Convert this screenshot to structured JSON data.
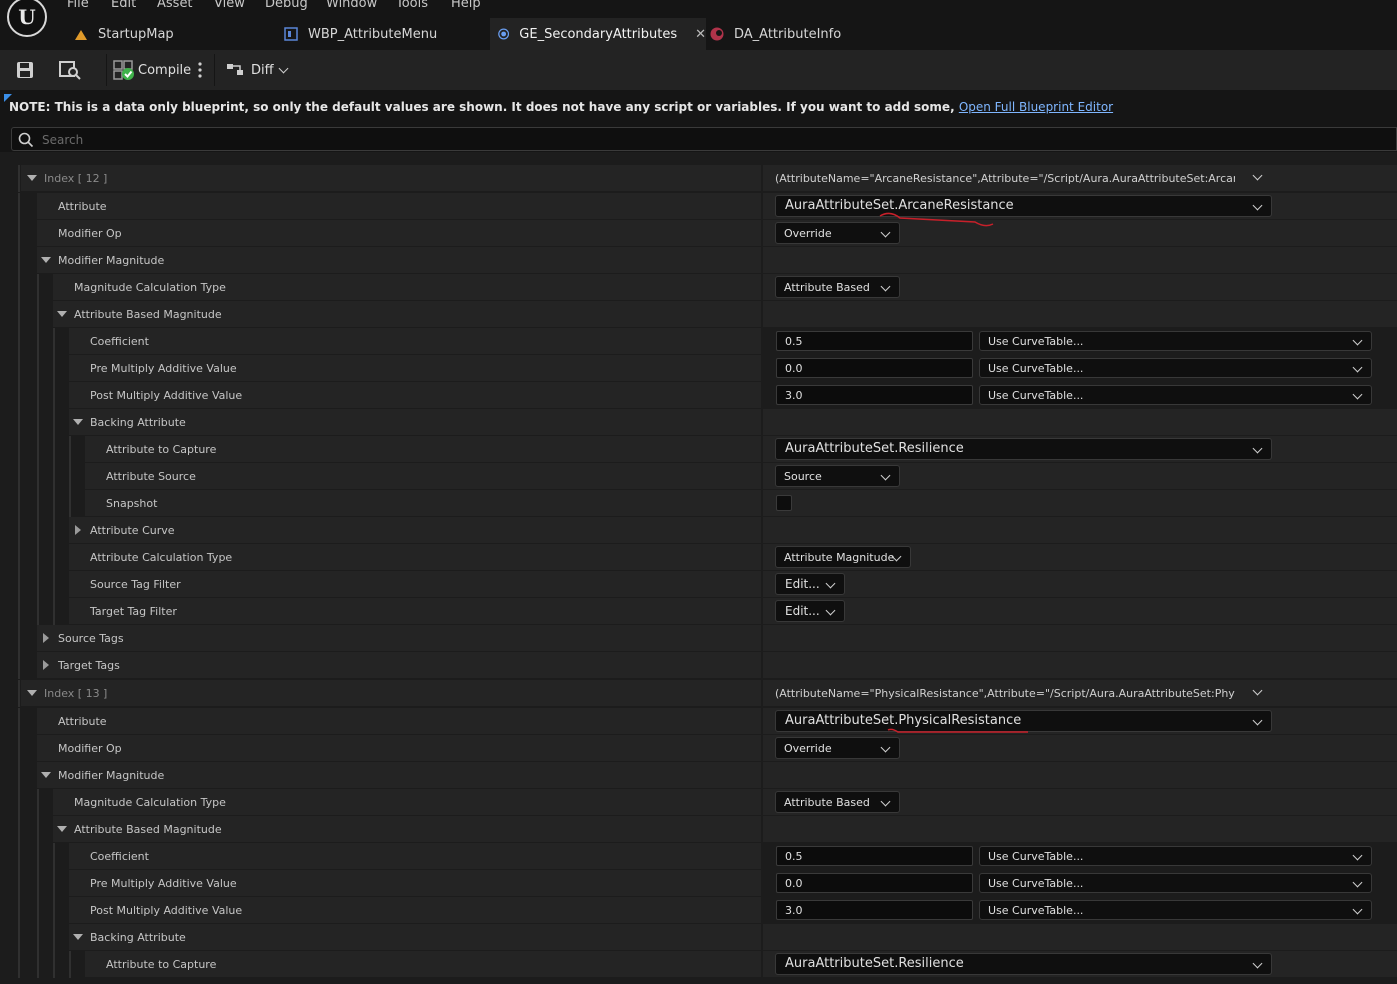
{
  "menu": [
    "File",
    "Edit",
    "Asset",
    "View",
    "Debug",
    "Window",
    "Tools",
    "Help"
  ],
  "tabs": [
    {
      "label": "StartupMap",
      "icon": "level-icon"
    },
    {
      "label": "WBP_AttributeMenu",
      "icon": "widget-blueprint-icon"
    },
    {
      "label": "GE_SecondaryAttributes",
      "icon": "gameplay-effect-icon",
      "active": true
    },
    {
      "label": "DA_AttributeInfo",
      "icon": "data-asset-icon"
    }
  ],
  "toolbar": {
    "compile_label": "Compile",
    "diff_label": "Diff"
  },
  "note": {
    "text": "NOTE: This is a data only blueprint, so only the default values are shown.  It does not have any script or variables.  If you want to add some, ",
    "link": "Open Full Blueprint Editor"
  },
  "search": {
    "placeholder": "Search"
  },
  "groups": [
    {
      "index_label": "Index [ 12 ]",
      "summary": "(AttributeName=\"ArcaneResistance\",Attribute=\"/Script/Aura.AuraAttributeSet:ArcaneResistance\",AttributeOwner=None)",
      "attribute_label": "Attribute",
      "attribute_value": "AuraAttributeSet.ArcaneResistance",
      "modifier_op_label": "Modifier Op",
      "modifier_op_value": "Override",
      "modifier_magnitude_label": "Modifier Magnitude",
      "mag_calc_type_label": "Magnitude Calculation Type",
      "mag_calc_type_value": "Attribute Based",
      "attr_based_mag_label": "Attribute Based Magnitude",
      "coefficient_label": "Coefficient",
      "coefficient_value": "0.5",
      "pre_mult_label": "Pre Multiply Additive Value",
      "pre_mult_value": "0.0",
      "post_mult_label": "Post Multiply Additive Value",
      "post_mult_value": "3.0",
      "curve_table_label": "Use CurveTable...",
      "backing_attr_label": "Backing Attribute",
      "attr_to_capture_label": "Attribute to Capture",
      "attr_to_capture_value": "AuraAttributeSet.Resilience",
      "attr_source_label": "Attribute Source",
      "attr_source_value": "Source",
      "snapshot_label": "Snapshot",
      "attr_curve_label": "Attribute Curve",
      "attr_calc_type_label": "Attribute Calculation Type",
      "attr_calc_type_value": "Attribute Magnitude",
      "source_tag_filter_label": "Source Tag Filter",
      "target_tag_filter_label": "Target Tag Filter",
      "edit_label": "Edit...",
      "source_tags_label": "Source Tags",
      "target_tags_label": "Target Tags"
    },
    {
      "index_label": "Index [ 13 ]",
      "summary": "(AttributeName=\"PhysicalResistance\",Attribute=\"/Script/Aura.AuraAttributeSet:PhysicalResistance\",AttributeOwner=None)",
      "attribute_label": "Attribute",
      "attribute_value": "AuraAttributeSet.PhysicalResistance",
      "modifier_op_label": "Modifier Op",
      "modifier_op_value": "Override",
      "modifier_magnitude_label": "Modifier Magnitude",
      "mag_calc_type_label": "Magnitude Calculation Type",
      "mag_calc_type_value": "Attribute Based",
      "attr_based_mag_label": "Attribute Based Magnitude",
      "coefficient_label": "Coefficient",
      "coefficient_value": "0.5",
      "pre_mult_label": "Pre Multiply Additive Value",
      "pre_mult_value": "0.0",
      "post_mult_label": "Post Multiply Additive Value",
      "post_mult_value": "3.0",
      "curve_table_label": "Use CurveTable...",
      "backing_attr_label": "Backing Attribute",
      "attr_to_capture_label": "Attribute to Capture",
      "attr_to_capture_value": "AuraAttributeSet.Resilience"
    }
  ],
  "colors": {
    "accent": "#3a8ee8",
    "annotation": "#c8202a",
    "panel": "#242424"
  }
}
